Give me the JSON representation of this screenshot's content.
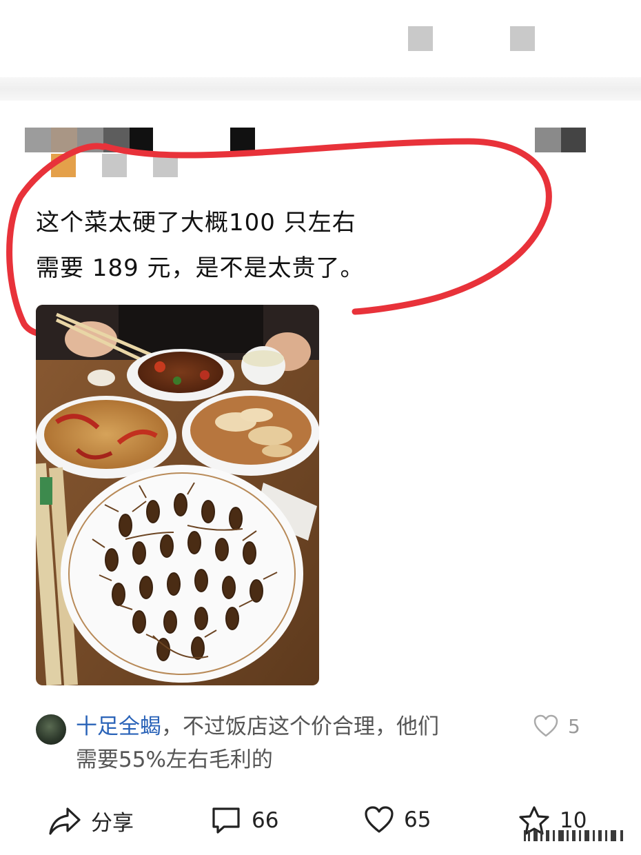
{
  "post": {
    "line1": "这个菜太硬了大概100 只左右",
    "line2": "需要 189 元，是不是太贵了。"
  },
  "comment": {
    "username": "十足全蝎",
    "text_line1": "，不过饭店这个价合理，他们",
    "text_line2": "需要55%左右毛利的",
    "likes": "5"
  },
  "actions": {
    "share_label": "分享",
    "comments_count": "66",
    "likes_count": "65",
    "favorites_count": "10"
  },
  "colors": {
    "annotation_red": "#e8323a",
    "username_blue": "#2a63b8",
    "icon_gray": "#999999"
  },
  "icons": [
    "share-icon",
    "comment-icon",
    "heart-icon",
    "star-icon",
    "like-heart-icon"
  ]
}
